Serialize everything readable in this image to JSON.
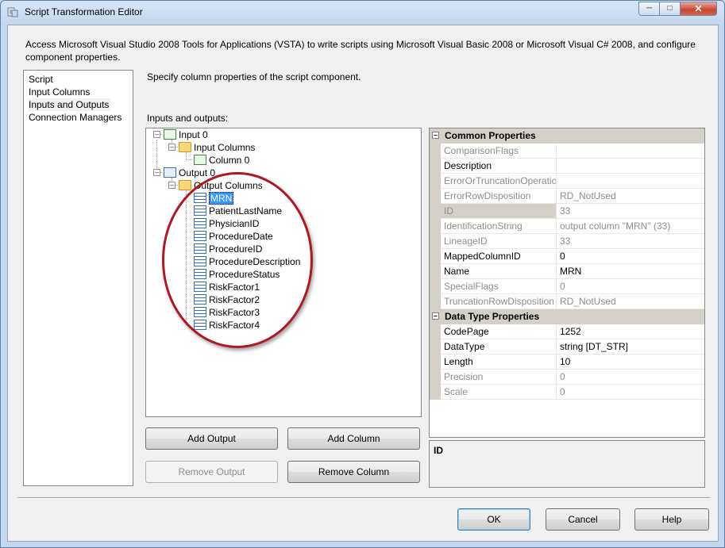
{
  "window": {
    "title": "Script Transformation Editor"
  },
  "description": "Access Microsoft Visual Studio 2008 Tools for Applications (VSTA) to write scripts using Microsoft Visual Basic 2008 or Microsoft Visual C# 2008, and configure component properties.",
  "nav": {
    "items": [
      "Script",
      "Input Columns",
      "Inputs and Outputs",
      "Connection Managers"
    ],
    "selected": "Inputs and Outputs"
  },
  "main": {
    "heading": "Specify column properties of the script component.",
    "tree_label": "Inputs and outputs:",
    "tree": {
      "input": "Input 0",
      "input_columns": "Input Columns",
      "input_column": "Column 0",
      "output": "Output 0",
      "output_columns": "Output Columns",
      "outputs": [
        "MRN",
        "PatientLastName",
        "PhysicianID",
        "ProcedureDate",
        "ProcedureID",
        "ProcedureDescription",
        "ProcedureStatus",
        "RiskFactor1",
        "RiskFactor2",
        "RiskFactor3",
        "RiskFactor4"
      ]
    },
    "buttons": {
      "add_output": "Add Output",
      "add_column": "Add Column",
      "remove_output": "Remove Output",
      "remove_column": "Remove Column"
    }
  },
  "properties": {
    "common_title": "Common Properties",
    "common": [
      {
        "name": "ComparisonFlags",
        "value": "",
        "readonly": true
      },
      {
        "name": "Description",
        "value": "",
        "readonly": false
      },
      {
        "name": "ErrorOrTruncationOperation",
        "value": "",
        "readonly": true
      },
      {
        "name": "ErrorRowDisposition",
        "value": "RD_NotUsed",
        "readonly": true
      },
      {
        "name": "ID",
        "value": "33",
        "readonly": true,
        "highlight": true
      },
      {
        "name": "IdentificationString",
        "value": "output column \"MRN\" (33)",
        "readonly": true
      },
      {
        "name": "LineageID",
        "value": "33",
        "readonly": true
      },
      {
        "name": "MappedColumnID",
        "value": "0",
        "readonly": false
      },
      {
        "name": "Name",
        "value": "MRN",
        "readonly": false
      },
      {
        "name": "SpecialFlags",
        "value": "0",
        "readonly": true
      },
      {
        "name": "TruncationRowDisposition",
        "value": "RD_NotUsed",
        "readonly": true
      }
    ],
    "datatype_title": "Data Type Properties",
    "datatype": [
      {
        "name": "CodePage",
        "value": "1252",
        "readonly": false
      },
      {
        "name": "DataType",
        "value": "string [DT_STR]",
        "readonly": false
      },
      {
        "name": "Length",
        "value": "10",
        "readonly": false
      },
      {
        "name": "Precision",
        "value": "0",
        "readonly": true
      },
      {
        "name": "Scale",
        "value": "0",
        "readonly": true
      }
    ],
    "help_title": "ID"
  },
  "footer": {
    "ok": "OK",
    "cancel": "Cancel",
    "help": "Help"
  },
  "annotation": {
    "color": "#b01820"
  }
}
